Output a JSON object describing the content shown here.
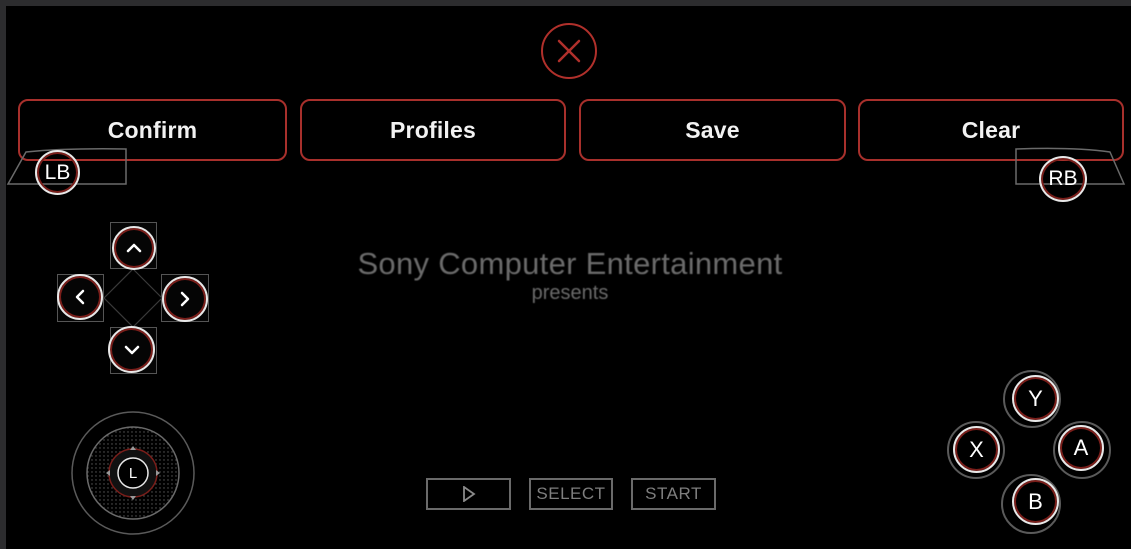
{
  "close": {
    "icon": "close-icon"
  },
  "toolbar": {
    "confirm_label": "Confirm",
    "profiles_label": "Profiles",
    "save_label": "Save",
    "clear_label": "Clear"
  },
  "shoulders": {
    "left_label": "LB",
    "right_label": "RB"
  },
  "dpad": {
    "up_icon": "chevron-up-icon",
    "down_icon": "chevron-down-icon",
    "left_icon": "chevron-left-icon",
    "right_icon": "chevron-right-icon"
  },
  "splash": {
    "line1": "Sony Computer Entertainment",
    "line2": "presents"
  },
  "stick": {
    "label": "L"
  },
  "system_buttons": {
    "play_icon": "play-icon",
    "select_label": "SELECT",
    "start_label": "START"
  },
  "face_buttons": {
    "y": "Y",
    "x": "X",
    "a": "A",
    "b": "B"
  },
  "colors": {
    "accent": "#b0302b",
    "background": "#000000",
    "outline": "#e8e8e8"
  }
}
